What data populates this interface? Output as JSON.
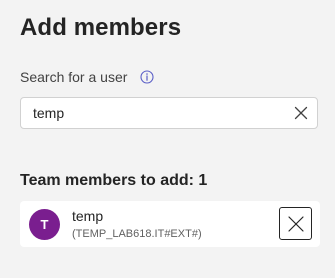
{
  "panel": {
    "title": "Add members"
  },
  "search": {
    "label": "Search for a user",
    "value": "temp",
    "info_icon": "info-icon",
    "clear_icon": "close-icon"
  },
  "members_section": {
    "heading": "Team members to add: 1",
    "members": [
      {
        "avatar_initial": "T",
        "name": "temp",
        "subtitle": "(TEMP_LAB618.IT#EXT#)",
        "remove_icon": "close-icon"
      }
    ]
  },
  "colors": {
    "background": "#f3f3f3",
    "avatar": "#7a1e8f",
    "info_icon": "#5b5fc7",
    "text": "#242424"
  }
}
